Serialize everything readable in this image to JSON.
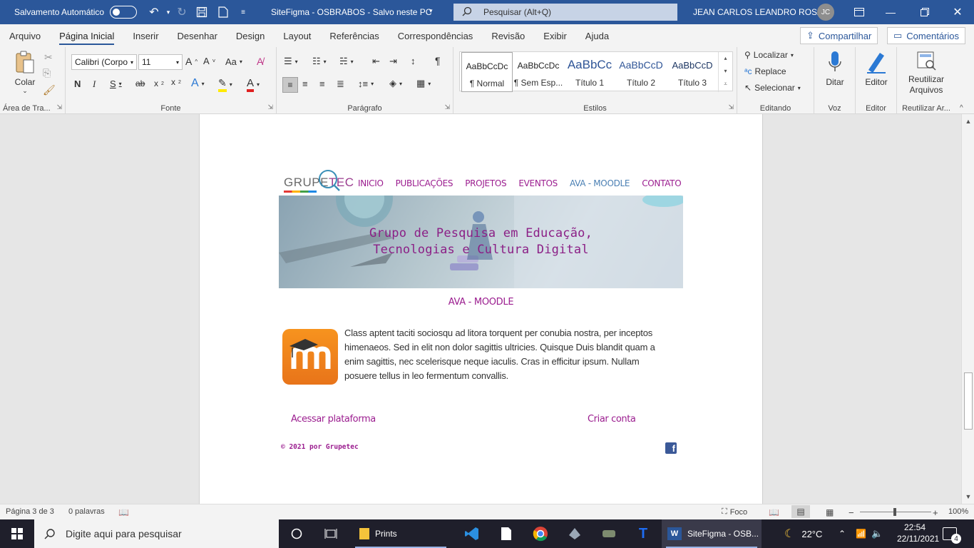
{
  "titlebar": {
    "autosave_label": "Salvamento Automático",
    "doc_title": "SiteFigma - OSBRABOS  -  Salvo neste PC",
    "search_placeholder": "Pesquisar (Alt+Q)",
    "user_name": "JEAN CARLOS LEANDRO ROSA",
    "user_initials": "JC"
  },
  "tabs": [
    "Arquivo",
    "Página Inicial",
    "Inserir",
    "Desenhar",
    "Design",
    "Layout",
    "Referências",
    "Correspondências",
    "Revisão",
    "Exibir",
    "Ajuda"
  ],
  "active_tab": "Página Inicial",
  "share": {
    "share_label": "Compartilhar",
    "comments_label": "Comentários"
  },
  "ribbon": {
    "clipboard": {
      "paste_label": "Colar",
      "group_label": "Área de Tra..."
    },
    "font": {
      "font_name": "Calibri (Corpo",
      "font_size": "11",
      "group_label": "Fonte"
    },
    "paragraph": {
      "group_label": "Parágrafo"
    },
    "styles": {
      "group_label": "Estilos",
      "items": [
        {
          "sample": "AaBbCcDc",
          "name": "¶ Normal"
        },
        {
          "sample": "AaBbCcDc",
          "name": "¶ Sem Esp..."
        },
        {
          "sample": "AaBbCc",
          "name": "Título 1"
        },
        {
          "sample": "AaBbCcD",
          "name": "Título 2"
        },
        {
          "sample": "AaBbCcD",
          "name": "Título 3"
        }
      ]
    },
    "editing": {
      "find_label": "Localizar",
      "replace_label": "Replace",
      "select_label": "Selecionar",
      "group_label": "Editando"
    },
    "voice": {
      "dictate_label": "Ditar",
      "group_label": "Voz"
    },
    "editor": {
      "editor_label": "Editor",
      "group_label": "Editor"
    },
    "reuse": {
      "reuse_label_1": "Reutilizar",
      "reuse_label_2": "Arquivos",
      "group_label": "Reutilizar Ar..."
    }
  },
  "site": {
    "logo_grupe": "GRUPE",
    "logo_tec": "TEC",
    "nav": [
      "INICIO",
      "PUBLICAÇÕES",
      "PROJETOS",
      "EVENTOS",
      "AVA - MOODLE",
      "CONTATO"
    ],
    "nav_active": "AVA - MOODLE",
    "banner_line1": "Grupo de Pesquisa em Educação,",
    "banner_line2": "Tecnologias e Cultura Digital",
    "section_title": "AVA - MOODLE",
    "body_text": "Class aptent taciti sociosqu ad litora torquent per conubia nostra, per inceptos himenaeos. Sed in elit non dolor sagittis ultricies. Quisque Duis blandit quam a enim sagittis, nec scelerisque neque iaculis. Cras in efficitur ipsum. Nullam posuere tellus in leo fermentum convallis.",
    "link_access": "Acessar plataforma",
    "link_create": "Criar conta",
    "copyright": "© 2021 por Grupetec"
  },
  "statusbar": {
    "page_info": "Página 3 de 3",
    "word_count": "0 palavras",
    "focus_label": "Foco",
    "zoom": "100%"
  },
  "taskbar": {
    "search_placeholder": "Digite aqui para pesquisar",
    "prints_label": "Prints",
    "word_label": "SiteFigma - OSB...",
    "temperature": "22°C",
    "time": "22:54",
    "date": "22/11/2021",
    "notifications": "4"
  }
}
